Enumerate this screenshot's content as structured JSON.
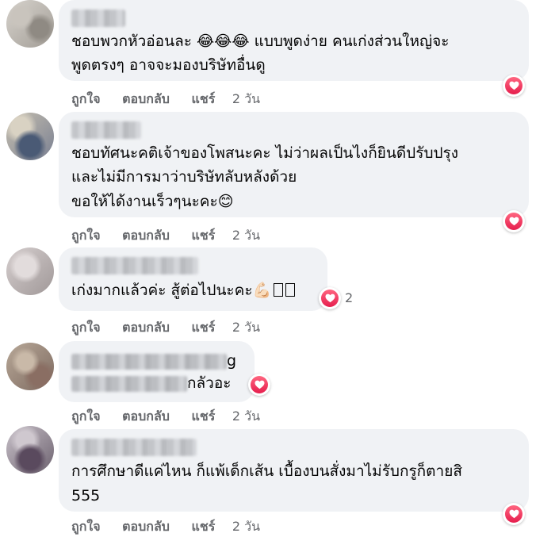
{
  "comments": [
    {
      "lines": [
        "ชอบพวกหัวอ่อนละ 😂😂😂 แบบพูดง่าย คนเก่งส่วนใหญ่จะ",
        "พูดตรงๆ อาจจะมองบริษัทอื่นดู"
      ],
      "reaction_icon": "heart-icon",
      "time": "2 วัน"
    },
    {
      "lines": [
        "ชอบทัศนะคติเจ้าของโพสนะคะ ไม่ว่าผลเป็นไงก็ยินดีปรับปรุง",
        "และไม่มีการมาว่าบริษัทลับหลังด้วย",
        "ขอให้ได้งานเร็วๆนะคะ😊"
      ],
      "reaction_icon": "heart-icon",
      "time": "2 วัน"
    },
    {
      "lines": [
        "เก่งมากแล้วค่ะ สู้ต่อไปนะคะ💪🏻"
      ],
      "reaction_icon": "heart-icon",
      "reaction_count": "2",
      "time": "2 วัน"
    },
    {
      "lines": [
        "g",
        "กลัวอะ"
      ],
      "reaction_icon": "heart-icon",
      "time": "2 วัน"
    },
    {
      "lines": [
        "การศึกษาดีแค่ไหน ก็แพ้เด็กเส้น เบื้องบนสั่งมาไม่รับกรูก็ตายสิ",
        "555"
      ],
      "reaction_icon": "heart-icon",
      "time": "2 วัน"
    }
  ],
  "actions": {
    "like": "ถูกใจ",
    "reply": "ตอบกลับ",
    "share": "แชร์"
  },
  "colors": {
    "bubble": "#f0f2f5",
    "action_text": "#65676b",
    "heart": "#f33e58"
  }
}
